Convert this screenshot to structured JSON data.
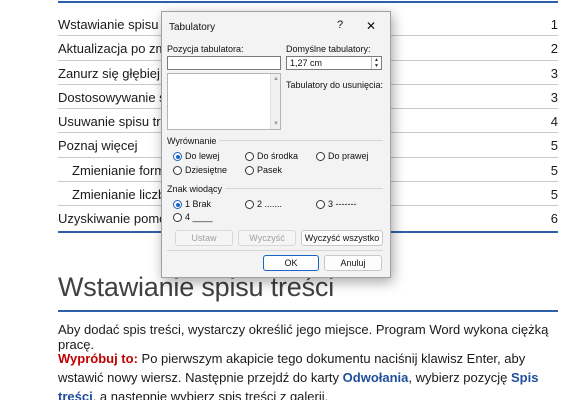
{
  "document": {
    "toc": [
      {
        "text": "Wstawianie spisu tr",
        "page": "1",
        "sub": false
      },
      {
        "text": "Aktualizacja po zmi",
        "page": "2",
        "sub": false
      },
      {
        "text": "Zanurz się głębiej n",
        "page": "3",
        "sub": false
      },
      {
        "text": "Dostosowywanie sp",
        "page": "3",
        "sub": false
      },
      {
        "text": "Usuwanie spisu tres",
        "page": "4",
        "sub": false
      },
      {
        "text": "Poznaj więcej",
        "page": "5",
        "sub": false
      },
      {
        "text": "Zmienianie forma",
        "page": "5",
        "sub": true
      },
      {
        "text": "Zmienianie liczby",
        "page": "5",
        "sub": true
      },
      {
        "text": "Uzyskiwanie pomoc",
        "page": "6",
        "sub": false
      }
    ],
    "heading": "Wstawianie spisu treści",
    "para1": "Aby dodać spis treści, wystarczy określić jego miejsce. Program Word wykona ciężką pracę.",
    "para2": {
      "lead": "Wypróbuj to:",
      "t1": " Po pierwszym akapicie tego dokumentu naciśnij klawisz Enter, aby wstawić nowy wiersz. Następnie przejdź do karty ",
      "link1": "Odwołania",
      "t2": ", wybierz pozycję ",
      "link2": "Spis treści",
      "t3": ", a następnie wybierz spis treści z galerii."
    }
  },
  "dialog": {
    "title": "Tabulatory",
    "help": "?",
    "close": "✕",
    "position_label": "Pozycja tabulatora:",
    "position_value": "",
    "default_label": "Domyślne tabulatory:",
    "default_value": "1,27 cm",
    "to_clear_label": "Tabulatory do usunięcia:",
    "alignment_label": "Wyrównanie",
    "alignment_options": [
      "Do lewej",
      "Do środka",
      "Do prawej",
      "Dziesiętne",
      "Pasek"
    ],
    "alignment_selected": "Do lewej",
    "leader_label": "Znak wiodący",
    "leader_options": [
      "1 Brak",
      "2 .......",
      "3 -------",
      "4 ____"
    ],
    "leader_selected": "1 Brak",
    "btn_set": "Ustaw",
    "btn_clear": "Wyczyść",
    "btn_clear_all": "Wyczyść wszystko",
    "btn_ok": "OK",
    "btn_cancel": "Anuluj"
  },
  "colors": {
    "accent": "#1a64c6",
    "rule": "#2e5fa8",
    "red": "#c00000",
    "link": "#1f4e9c"
  }
}
